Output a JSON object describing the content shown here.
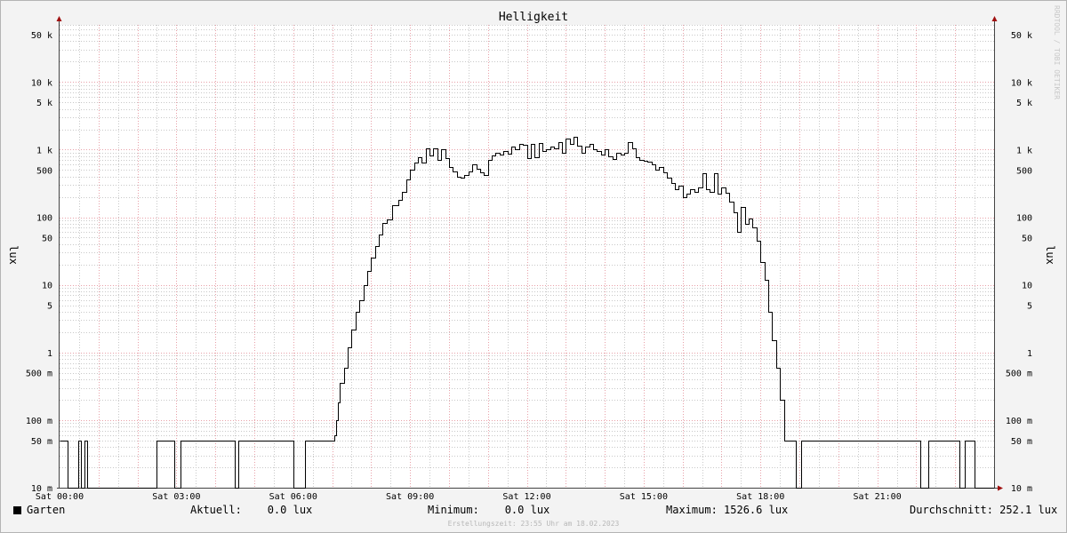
{
  "watermark": "RRDTOOL / TOBI OETIKER",
  "legend": {
    "series_name": "Garten",
    "series_color": "#000000",
    "current": "Aktuell:    0.0 lux",
    "minimum": "Minimum:    0.0 lux",
    "maximum": "Maximum: 1526.6 lux",
    "average": "Durchschnitt: 252.1 lux"
  },
  "credit": "Erstellungszeit: 23:55 Uhr am 18.02.2023",
  "colors": {
    "major_grid": "#e8a0a8",
    "minor_grid": "#c8c8c8",
    "arrow": "#a01010",
    "canvas": "#ffffff"
  },
  "chart_data": {
    "type": "line",
    "title": "Helligkeit",
    "ylabel": "lux",
    "yscale": "log",
    "ylim": [
      0.01,
      70000
    ],
    "xlim": [
      0,
      24
    ],
    "x_unit": "hours (Sat)",
    "xticks": [
      {
        "t": 0,
        "label": "Sat 00:00"
      },
      {
        "t": 3,
        "label": "Sat 03:00"
      },
      {
        "t": 6,
        "label": "Sat 06:00"
      },
      {
        "t": 9,
        "label": "Sat 09:00"
      },
      {
        "t": 12,
        "label": "Sat 12:00"
      },
      {
        "t": 15,
        "label": "Sat 15:00"
      },
      {
        "t": 18,
        "label": "Sat 18:00"
      },
      {
        "t": 21,
        "label": "Sat 21:00"
      }
    ],
    "yticks": [
      {
        "v": 0.01,
        "label": "10 m"
      },
      {
        "v": 0.05,
        "label": "50 m"
      },
      {
        "v": 0.1,
        "label": "100 m"
      },
      {
        "v": 0.5,
        "label": "500 m"
      },
      {
        "v": 1,
        "label": "1"
      },
      {
        "v": 5,
        "label": "5"
      },
      {
        "v": 10,
        "label": "10"
      },
      {
        "v": 50,
        "label": "50"
      },
      {
        "v": 100,
        "label": "100"
      },
      {
        "v": 500,
        "label": "500"
      },
      {
        "v": 1000,
        "label": "1 k"
      },
      {
        "v": 5000,
        "label": "5 k"
      },
      {
        "v": 10000,
        "label": "10 k"
      },
      {
        "v": 50000,
        "label": "50 k"
      }
    ],
    "grid": true,
    "series": [
      {
        "name": "Garten",
        "step": true,
        "points": [
          [
            0.0,
            0.05
          ],
          [
            0.2,
            0.01
          ],
          [
            0.48,
            0.05
          ],
          [
            0.55,
            0.01
          ],
          [
            0.63,
            0.05
          ],
          [
            0.7,
            0.01
          ],
          [
            2.48,
            0.05
          ],
          [
            2.95,
            0.01
          ],
          [
            3.1,
            0.05
          ],
          [
            4.5,
            0.01
          ],
          [
            4.6,
            0.05
          ],
          [
            6.0,
            0.01
          ],
          [
            6.3,
            0.05
          ],
          [
            7.05,
            0.06
          ],
          [
            7.1,
            0.1
          ],
          [
            7.15,
            0.18
          ],
          [
            7.2,
            0.35
          ],
          [
            7.3,
            0.6
          ],
          [
            7.4,
            1.2
          ],
          [
            7.5,
            2.2
          ],
          [
            7.6,
            4
          ],
          [
            7.7,
            6
          ],
          [
            7.8,
            10
          ],
          [
            7.9,
            16
          ],
          [
            8.0,
            25
          ],
          [
            8.1,
            38
          ],
          [
            8.2,
            55
          ],
          [
            8.3,
            82
          ],
          [
            8.4,
            92
          ],
          [
            8.55,
            150
          ],
          [
            8.7,
            180
          ],
          [
            8.8,
            240
          ],
          [
            8.9,
            360
          ],
          [
            9.0,
            500
          ],
          [
            9.1,
            650
          ],
          [
            9.2,
            780
          ],
          [
            9.3,
            650
          ],
          [
            9.4,
            1050
          ],
          [
            9.5,
            820
          ],
          [
            9.6,
            1050
          ],
          [
            9.7,
            700
          ],
          [
            9.8,
            1000
          ],
          [
            9.9,
            760
          ],
          [
            10.0,
            560
          ],
          [
            10.1,
            470
          ],
          [
            10.2,
            400
          ],
          [
            10.3,
            380
          ],
          [
            10.4,
            420
          ],
          [
            10.5,
            480
          ],
          [
            10.6,
            600
          ],
          [
            10.7,
            520
          ],
          [
            10.8,
            460
          ],
          [
            10.9,
            420
          ],
          [
            11.0,
            700
          ],
          [
            11.1,
            820
          ],
          [
            11.2,
            900
          ],
          [
            11.3,
            850
          ],
          [
            11.4,
            950
          ],
          [
            11.5,
            880
          ],
          [
            11.6,
            1100
          ],
          [
            11.7,
            1000
          ],
          [
            11.8,
            1200
          ],
          [
            11.9,
            1180
          ],
          [
            12.0,
            760
          ],
          [
            12.1,
            1200
          ],
          [
            12.2,
            780
          ],
          [
            12.3,
            1250
          ],
          [
            12.4,
            950
          ],
          [
            12.5,
            1000
          ],
          [
            12.6,
            1100
          ],
          [
            12.7,
            1050
          ],
          [
            12.8,
            1300
          ],
          [
            12.9,
            900
          ],
          [
            13.0,
            1450
          ],
          [
            13.1,
            1200
          ],
          [
            13.2,
            1526.6
          ],
          [
            13.3,
            1150
          ],
          [
            13.4,
            900
          ],
          [
            13.5,
            1100
          ],
          [
            13.6,
            1200
          ],
          [
            13.7,
            1000
          ],
          [
            13.8,
            950
          ],
          [
            13.9,
            850
          ],
          [
            14.0,
            1000
          ],
          [
            14.1,
            800
          ],
          [
            14.2,
            720
          ],
          [
            14.3,
            900
          ],
          [
            14.4,
            850
          ],
          [
            14.5,
            900
          ],
          [
            14.6,
            1300
          ],
          [
            14.7,
            1050
          ],
          [
            14.8,
            780
          ],
          [
            14.9,
            700
          ],
          [
            15.0,
            680
          ],
          [
            15.1,
            660
          ],
          [
            15.2,
            600
          ],
          [
            15.3,
            500
          ],
          [
            15.4,
            550
          ],
          [
            15.5,
            460
          ],
          [
            15.6,
            380
          ],
          [
            15.7,
            320
          ],
          [
            15.8,
            260
          ],
          [
            15.9,
            290
          ],
          [
            16.0,
            200
          ],
          [
            16.1,
            220
          ],
          [
            16.2,
            260
          ],
          [
            16.3,
            240
          ],
          [
            16.4,
            280
          ],
          [
            16.5,
            450
          ],
          [
            16.6,
            260
          ],
          [
            16.7,
            240
          ],
          [
            16.8,
            450
          ],
          [
            16.9,
            220
          ],
          [
            17.0,
            280
          ],
          [
            17.1,
            230
          ],
          [
            17.2,
            170
          ],
          [
            17.3,
            120
          ],
          [
            17.4,
            60
          ],
          [
            17.5,
            140
          ],
          [
            17.6,
            80
          ],
          [
            17.7,
            95
          ],
          [
            17.8,
            70
          ],
          [
            17.9,
            45
          ],
          [
            18.0,
            22
          ],
          [
            18.1,
            12
          ],
          [
            18.2,
            4
          ],
          [
            18.3,
            1.5
          ],
          [
            18.4,
            0.6
          ],
          [
            18.5,
            0.2
          ],
          [
            18.6,
            0.05
          ],
          [
            18.9,
            0.01
          ],
          [
            19.05,
            0.05
          ],
          [
            22.1,
            0.01
          ],
          [
            22.3,
            0.05
          ],
          [
            23.1,
            0.01
          ],
          [
            23.25,
            0.05
          ],
          [
            23.5,
            0.01
          ],
          [
            24.0,
            0.01
          ]
        ]
      }
    ]
  }
}
